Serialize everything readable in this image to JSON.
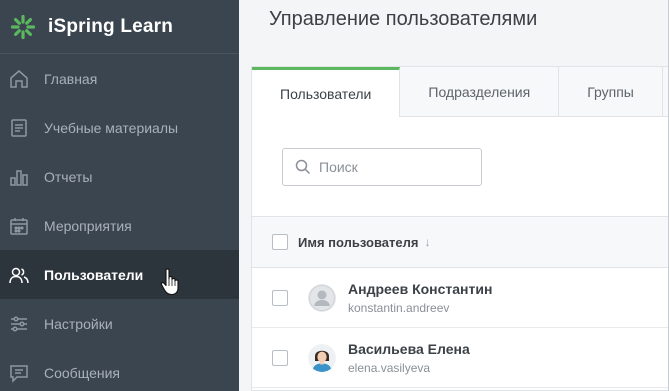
{
  "app": {
    "logo_text": "iSpring Learn",
    "accent_color": "#5bb85f"
  },
  "sidebar": {
    "items": [
      {
        "label": "Главная",
        "icon": "home-icon"
      },
      {
        "label": "Учебные материалы",
        "icon": "courses-icon"
      },
      {
        "label": "Отчеты",
        "icon": "reports-icon"
      },
      {
        "label": "Мероприятия",
        "icon": "calendar-icon"
      },
      {
        "label": "Пользователи",
        "icon": "users-icon",
        "active": true
      },
      {
        "label": "Настройки",
        "icon": "settings-icon"
      },
      {
        "label": "Сообщения",
        "icon": "messages-icon"
      }
    ]
  },
  "main": {
    "title": "Управление пользователями",
    "tabs": [
      {
        "label": "Пользователи",
        "active": true
      },
      {
        "label": "Подразделения"
      },
      {
        "label": "Группы"
      }
    ],
    "search": {
      "placeholder": "Поиск",
      "value": ""
    },
    "table": {
      "column_header": "Имя пользователя",
      "rows": [
        {
          "name": "Андреев Константин",
          "login": "konstantin.andreev",
          "avatar": "default-avatar"
        },
        {
          "name": "Васильева Елена",
          "login": "elena.vasilyeva",
          "avatar": "photo-avatar"
        }
      ]
    }
  }
}
